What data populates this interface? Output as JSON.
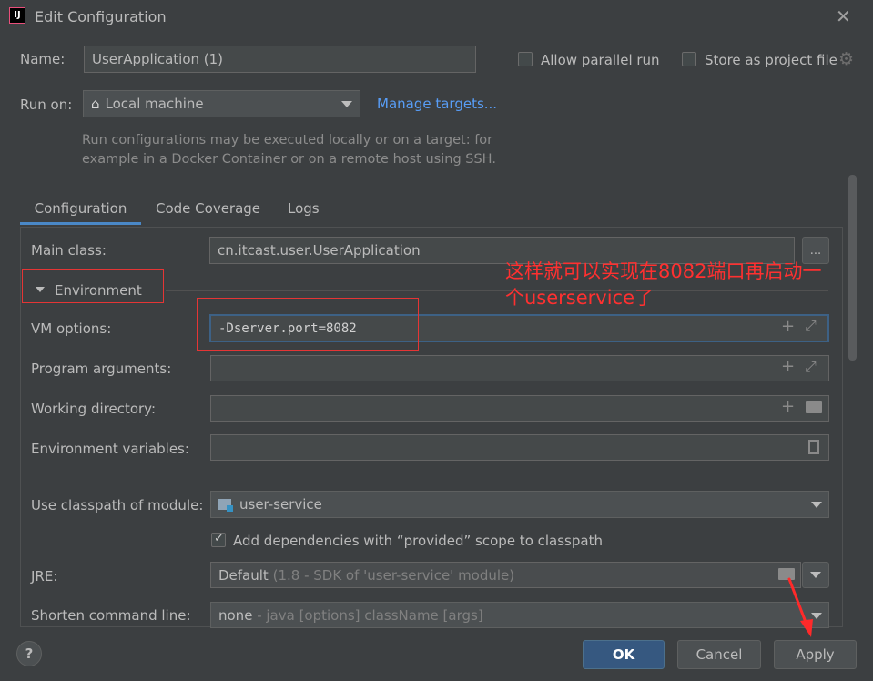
{
  "window": {
    "title": "Edit Configuration",
    "app_icon_text": "IJ"
  },
  "name_row": {
    "label": "Name:",
    "value": "UserApplication (1)"
  },
  "options": {
    "allow_parallel_run": "Allow parallel run",
    "store_as_project_file": "Store as project file"
  },
  "run_on": {
    "label": "Run on:",
    "value": "Local machine",
    "manage_targets": "Manage targets...",
    "hint_line1": "Run configurations may be executed locally or on a target: for",
    "hint_line2": "example in a Docker Container or on a remote host using SSH."
  },
  "tabs": [
    {
      "label": "Configuration",
      "active": true
    },
    {
      "label": "Code Coverage",
      "active": false
    },
    {
      "label": "Logs",
      "active": false
    }
  ],
  "form": {
    "main_class_label": "Main class:",
    "main_class_value": "cn.itcast.user.UserApplication",
    "browse_button": "...",
    "environment_section": "Environment",
    "vm_options_label": "VM options:",
    "vm_options_value": "-Dserver.port=8082",
    "program_arguments_label": "Program arguments:",
    "working_directory_label": "Working directory:",
    "environment_variables_label": "Environment variables:",
    "classpath_label": "Use classpath of module:",
    "classpath_value": "user-service",
    "add_dependencies_label": "Add dependencies with “provided” scope to classpath",
    "add_dependencies_checked": true,
    "jre_label": "JRE:",
    "jre_value_main": "Default",
    "jre_value_detail": "(1.8 - SDK of 'user-service' module)",
    "shorten_label": "Shorten command line:",
    "shorten_value_main": "none",
    "shorten_value_detail": "- java [options] className [args]"
  },
  "annotation": {
    "line1": "这样就可以实现在8082端口再启动一",
    "line2": "个userservice了",
    "color": "#ff3030"
  },
  "footer": {
    "help": "?",
    "ok": "OK",
    "cancel": "Cancel",
    "apply": "Apply"
  },
  "colors": {
    "background": "#3c3f41",
    "field": "#45494a",
    "accent": "#4a88c7",
    "link": "#589df6",
    "primary_button": "#365880"
  }
}
